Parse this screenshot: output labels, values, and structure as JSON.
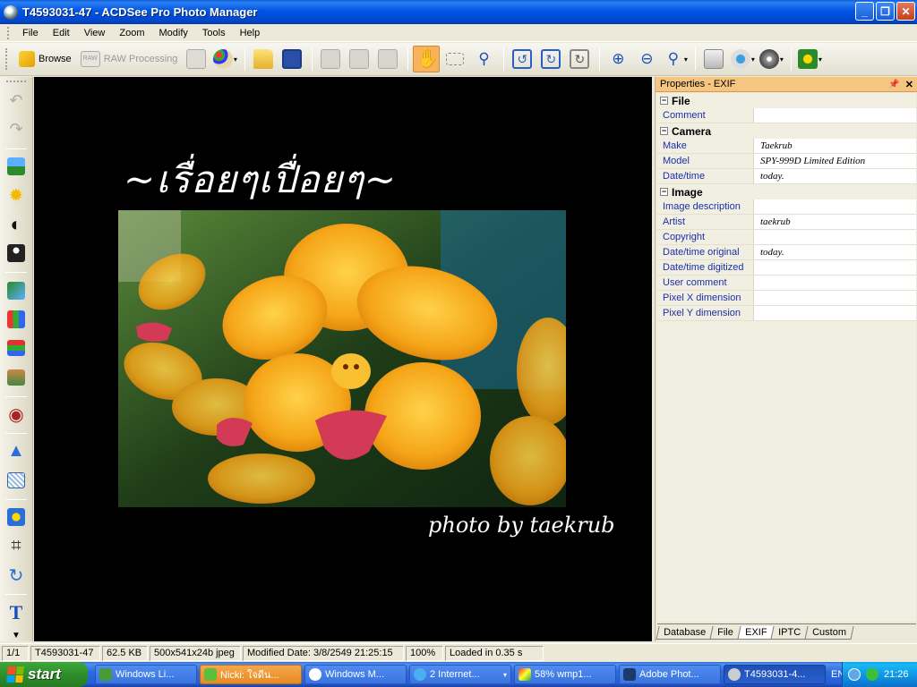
{
  "window": {
    "title": "T4593031-47 - ACDSee Pro Photo Manager",
    "buttons": [
      "_",
      "❐",
      "✕"
    ]
  },
  "menu": [
    "File",
    "Edit",
    "View",
    "Zoom",
    "Modify",
    "Tools",
    "Help"
  ],
  "toolbar": {
    "browse_label": "Browse",
    "raw_label": "RAW Processing"
  },
  "viewer": {
    "thai_caption": "~เรื่อยๆเปื่อยๆ~",
    "credit": "photo by taekrub"
  },
  "properties": {
    "title": "Properties - EXIF",
    "sections": [
      {
        "name": "File",
        "rows": [
          {
            "key": "Comment",
            "value": ""
          }
        ]
      },
      {
        "name": "Camera",
        "rows": [
          {
            "key": "Make",
            "value": "Taekrub"
          },
          {
            "key": "Model",
            "value": "SPY-999D Limited Edition"
          },
          {
            "key": "Date/time",
            "value": "today."
          }
        ]
      },
      {
        "name": "Image",
        "rows": [
          {
            "key": "Image description",
            "value": ""
          },
          {
            "key": "Artist",
            "value": "taekrub"
          },
          {
            "key": "Copyright",
            "value": ""
          },
          {
            "key": "Date/time original",
            "value": "today."
          },
          {
            "key": "Date/time digitized",
            "value": ""
          },
          {
            "key": "User comment",
            "value": ""
          },
          {
            "key": "Pixel X dimension",
            "value": ""
          },
          {
            "key": "Pixel Y dimension",
            "value": ""
          }
        ]
      }
    ],
    "tabs": [
      "Database",
      "File",
      "EXIF",
      "IPTC",
      "Custom"
    ],
    "active_tab": "EXIF"
  },
  "status": {
    "position": "1/1",
    "filename": "T4593031-47",
    "size": "62.5 KB",
    "dimensions": "500x541x24b jpeg",
    "modified": "Modified Date: 3/8/2549 21:25:15",
    "zoom": "100%",
    "loaded": "Loaded in 0.35 s"
  },
  "taskbar": {
    "start": "start",
    "tasks": [
      {
        "label": "Windows Li...",
        "state": "normal"
      },
      {
        "label": "Nicki: ใจดีน...",
        "state": "flash"
      },
      {
        "label": "Windows M...",
        "state": "normal"
      },
      {
        "label": "2 Internet...",
        "state": "normal"
      },
      {
        "label": "58% wmp1...",
        "state": "normal"
      },
      {
        "label": "Adobe Phot...",
        "state": "normal"
      },
      {
        "label": "T4593031-4...",
        "state": "active"
      }
    ],
    "lang": "EN",
    "clock": "21:26"
  },
  "colors": {
    "titlebar": "#0055e5",
    "props_header": "#f6c580",
    "key_text": "#1a2fa8"
  }
}
